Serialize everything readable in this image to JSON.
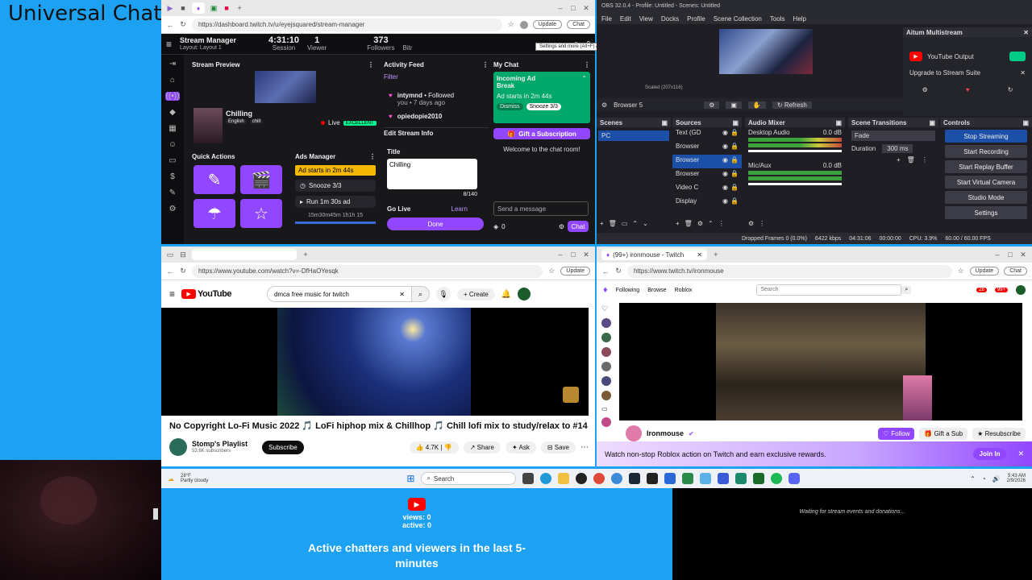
{
  "overlay": {
    "title": "Universal Chat",
    "views": "views: 0",
    "active": "active: 0",
    "caption": "Active chatters and viewers in the last 5-minutes",
    "events": "Waiting for stream events and donations..."
  },
  "twitch_mgr": {
    "url": "https://dashboard.twitch.tv/u/eyejsquared/stream-manager",
    "update": "Update",
    "chat_tab": "Chat",
    "tooltip": "Settings and more (Alt+F) An update is available",
    "app_title": "Stream Manager",
    "layout": "Layout: Layout 1",
    "session_val": "4:31:10",
    "session_lbl": "Session",
    "viewer_val": "1",
    "viewer_lbl": "Viewer",
    "followers_val": "373",
    "followers_lbl": "Followers",
    "bitrate_lbl": "Bitr",
    "preview_h": "Stream Preview",
    "stream_title": "Chilling",
    "tags": [
      "English",
      "chill"
    ],
    "live": "Live",
    "live_quality": "EXCELLENT",
    "quick_actions": "Quick Actions",
    "ads_manager": "Ads Manager",
    "ad_starts": "Ad starts in 2m 44s",
    "snooze": "Snooze 3/3",
    "run_ad": "Run 1m 30s ad",
    "ad_times": "15m30m45m 1h1h 15",
    "activity_h": "Activity Feed",
    "filter": "Filter",
    "act_user": "intymnd",
    "act_action": "Followed",
    "act_time": "you • 7 days ago",
    "act_user2": "opiedopie2010",
    "edit_h": "Edit Stream Info",
    "title_lbl": "Title",
    "title_val": "Chilling",
    "char_count": "8/140",
    "golive": "Go Live",
    "learn": "Learn",
    "done": "Done",
    "mychat_h": "My Chat",
    "incoming": "Incoming Ad Break",
    "ad_starts2": "Ad starts in 2m 44s",
    "dismiss": "Dismiss",
    "snooze2": "Snooze 3/3",
    "gift": "Gift a Subscription",
    "welcome": "Welcome to the chat room!",
    "send_ph": "Send a message",
    "chat_btn": "Chat",
    "points": "0"
  },
  "obs": {
    "title": "OBS 32.0.4 - Profile: Untitled - Scenes: Untitled",
    "menu": [
      "File",
      "Edit",
      "View",
      "Docks",
      "Profile",
      "Scene Collection",
      "Tools",
      "Help"
    ],
    "multistream_h": "Aitum Multistream",
    "yt_output": "YouTube Output",
    "upgrade": "Upgrade to Stream Suite",
    "scaled": "Scaled (207x116)",
    "browser5": "Browser 5",
    "refresh": "Refresh",
    "scenes_h": "Scenes",
    "scene1": "PC",
    "sources_h": "Sources",
    "sources": [
      "Text (GD",
      "Browser",
      "Browser",
      "Browser",
      "Video C",
      "Display"
    ],
    "mixer_h": "Audio Mixer",
    "desktop_audio": "Desktop Audio",
    "desktop_db": "0.0 dB",
    "mic": "Mic/Aux",
    "mic_db": "0.0 dB",
    "transitions_h": "Scene Transitions",
    "fade": "Fade",
    "duration_lbl": "Duration",
    "duration_val": "300 ms",
    "controls_h": "Controls",
    "controls": [
      "Stop Streaming",
      "Start Recording",
      "Start Replay Buffer",
      "Start Virtual Camera",
      "Studio Mode",
      "Settings"
    ],
    "status_dropped": "Dropped Frames 0 (0.0%)",
    "status_kbps": "6422 kbps",
    "status_time": "04:31:06",
    "status_rec": "00:00:00",
    "status_cpu": "CPU: 3.9%",
    "status_fps": "60.00 / 60.00 FPS"
  },
  "youtube": {
    "url": "https://www.youtube.com/watch?v=-DfHaOYesqk",
    "update": "Update",
    "logo": "YouTube",
    "search": "dmca free music for twitch",
    "create": "Create",
    "video_title": "No Copyright Lo-Fi Music 2022 🎵 LoFi hiphop mix & Chillhop 🎵 Chill lofi mix to study/relax to #14",
    "channel": "Stomp's Playlist",
    "subs": "53.6K subscribers",
    "subscribe": "Subscribe",
    "likes": "4.7K",
    "share": "Share",
    "ask": "Ask",
    "save": "Save"
  },
  "twitch_viewer": {
    "tab": "(99+) ironmouse - Twitch",
    "url": "https://www.twitch.tv/ironmouse",
    "update": "Update",
    "chat_tab": "Chat",
    "nav": [
      "Following",
      "Browse",
      "Roblox"
    ],
    "search_ph": "Search",
    "badge1": "28",
    "badge2": "99+",
    "streamer": "Ironmouse",
    "follow": "Follow",
    "gift_sub": "Gift a Sub",
    "resub": "Resubscribe",
    "banner": "Watch non-stop Roblox action on Twitch and earn exclusive rewards.",
    "join": "Join In"
  },
  "taskbar": {
    "weather_temp": "28°F",
    "weather_desc": "Partly cloudy",
    "search": "Search",
    "time": "5:43 AM",
    "date": "2/9/2026"
  },
  "colors": {
    "twitch_purple": "#9147ff",
    "background_blue": "#1da1f2",
    "youtube_red": "#ff0000",
    "live_green": "#00f593"
  }
}
